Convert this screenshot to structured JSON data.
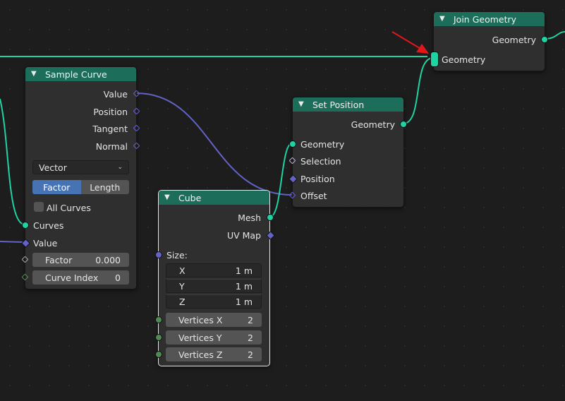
{
  "nodes": {
    "join": {
      "title": "Join Geometry",
      "output": "Geometry",
      "input": "Geometry"
    },
    "sample": {
      "title": "Sample Curve",
      "outputs": [
        "Value",
        "Position",
        "Tangent",
        "Normal"
      ],
      "dropdown": "Vector",
      "mode_options": [
        "Factor",
        "Length"
      ],
      "mode_selected": "Factor",
      "all_curves_label": "All Curves",
      "inputs": [
        "Curves",
        "Value"
      ],
      "factor": {
        "label": "Factor",
        "value": "0.000"
      },
      "curve_index": {
        "label": "Curve Index",
        "value": "0"
      }
    },
    "setpos": {
      "title": "Set Position",
      "output": "Geometry",
      "inputs": [
        "Geometry",
        "Selection",
        "Position",
        "Offset"
      ]
    },
    "cube": {
      "title": "Cube",
      "outputs": [
        "Mesh",
        "UV Map"
      ],
      "size_label": "Size:",
      "size": [
        {
          "label": "X",
          "value": "1 m"
        },
        {
          "label": "Y",
          "value": "1 m"
        },
        {
          "label": "Z",
          "value": "1 m"
        }
      ],
      "vertices": [
        {
          "label": "Vertices X",
          "value": "2"
        },
        {
          "label": "Vertices Y",
          "value": "2"
        },
        {
          "label": "Vertices Z",
          "value": "2"
        }
      ]
    }
  },
  "colors": {
    "geometry_socket": "#1fd3a2",
    "vector_socket": "#6363c7",
    "node_header": "#1c6e5b",
    "annotation_arrow": "#e3161c"
  },
  "icons": [
    "chevron-down-icon",
    "dropdown-chevron-icon",
    "annotation-arrow-icon"
  ]
}
